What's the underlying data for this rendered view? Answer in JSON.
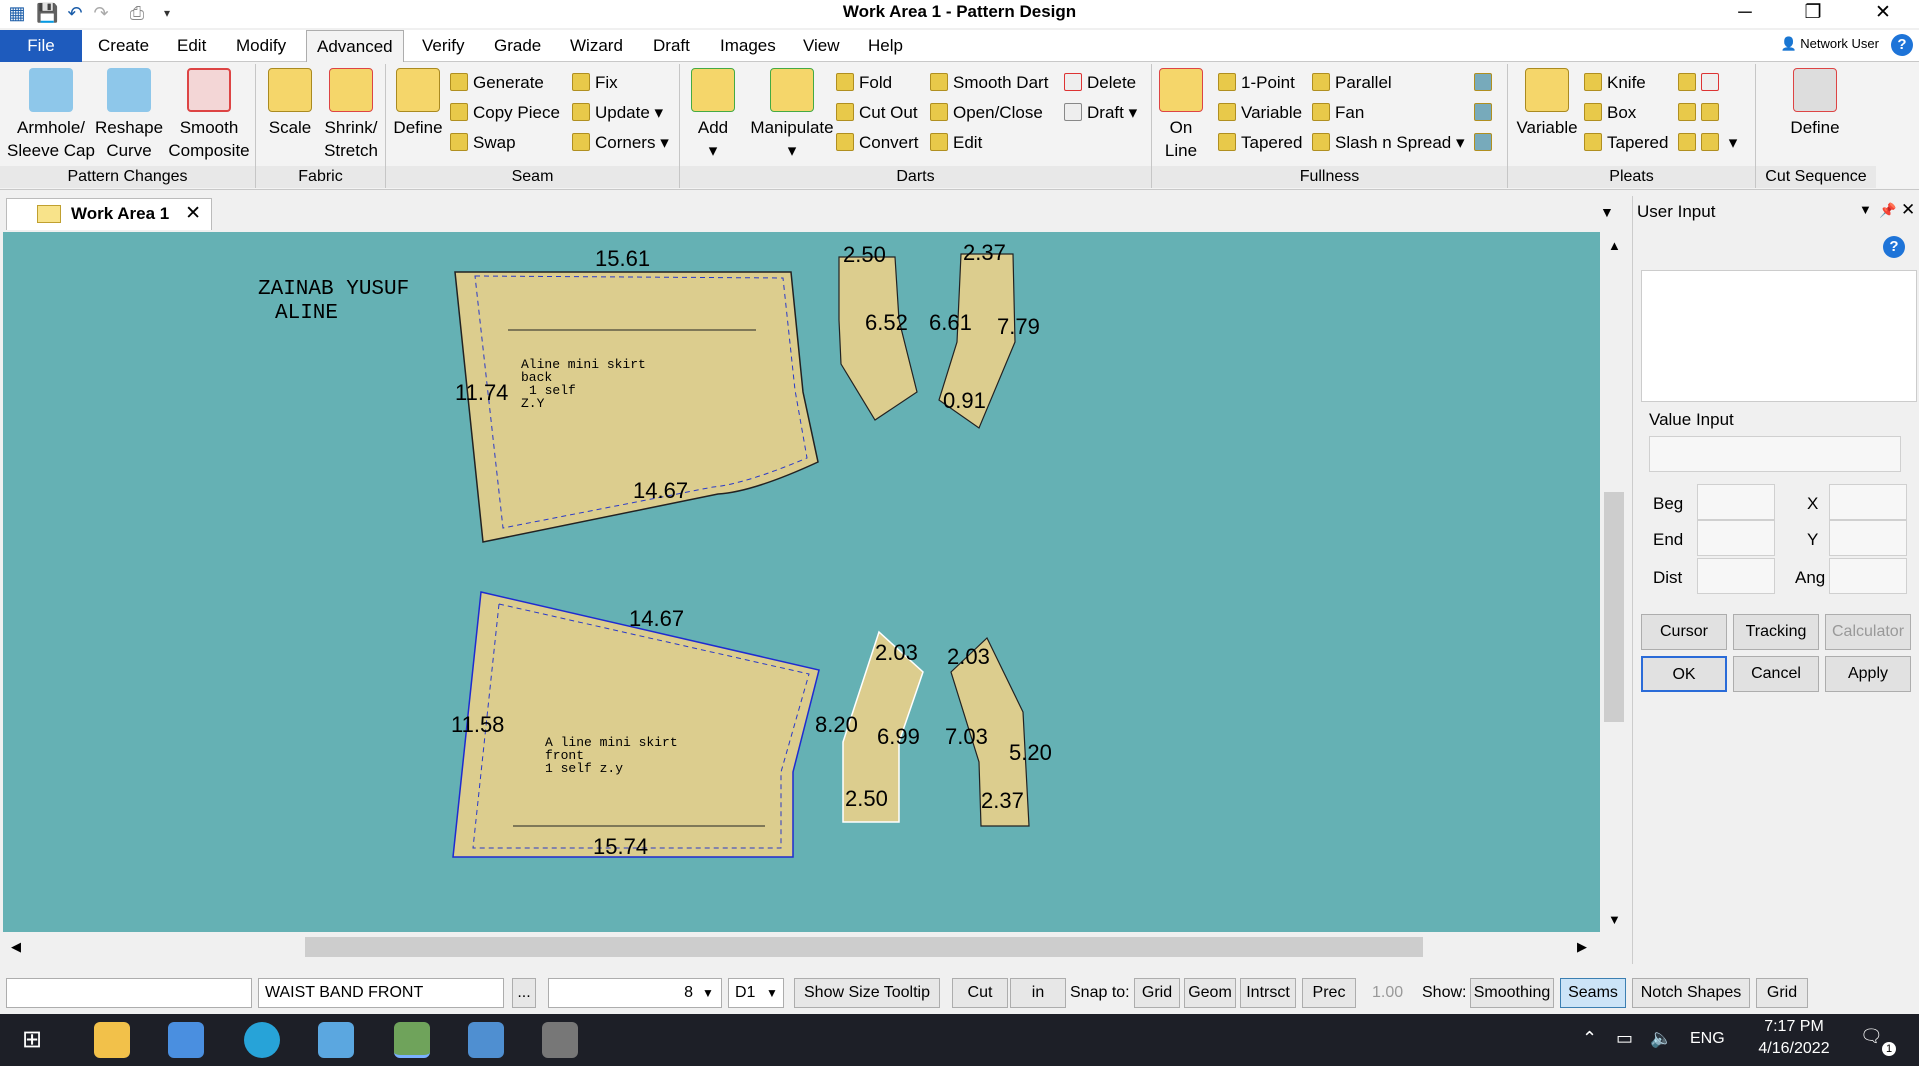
{
  "window": {
    "title": "Work Area 1 - Pattern Design"
  },
  "menu": {
    "file": "File",
    "items": [
      "Create",
      "Edit",
      "Modify",
      "Advanced",
      "Verify",
      "Grade",
      "Wizard",
      "Draft",
      "Images",
      "View",
      "Help"
    ],
    "network_user": "Network User"
  },
  "ribbon": {
    "pattern_changes": {
      "label": "Pattern Changes",
      "armhole": "Armhole/",
      "sleeve": "Sleeve Cap",
      "reshape": "Reshape",
      "curve": "Curve",
      "smooth": "Smooth",
      "composite": "Composite"
    },
    "fabric": {
      "label": "Fabric",
      "scale": "Scale",
      "shrink": "Shrink/",
      "stretch": "Stretch"
    },
    "seam": {
      "label": "Seam",
      "define": "Define",
      "generate": "Generate",
      "copy_piece": "Copy Piece",
      "swap": "Swap",
      "fix": "Fix",
      "update": "Update",
      "corners": "Corners"
    },
    "darts": {
      "label": "Darts",
      "add": "Add",
      "manipulate": "Manipulate",
      "fold": "Fold",
      "cut_out": "Cut Out",
      "convert": "Convert",
      "smooth_dart": "Smooth Dart",
      "open_close": "Open/Close",
      "edit": "Edit",
      "delete": "Delete",
      "draft": "Draft"
    },
    "fullness": {
      "label": "Fullness",
      "on": "On",
      "line": "Line",
      "one_point": "1-Point",
      "variable": "Variable",
      "tapered": "Tapered",
      "parallel": "Parallel",
      "fan": "Fan",
      "slash": "Slash n Spread"
    },
    "pleats": {
      "label": "Pleats",
      "variable": "Variable",
      "knife": "Knife",
      "box": "Box",
      "tapered": "Tapered"
    },
    "cut_sequence": {
      "label": "Cut Sequence",
      "define": "Define"
    }
  },
  "doc_tab": {
    "label": "Work Area 1"
  },
  "canvas": {
    "owner_text": "ZAINAB  YUSUF",
    "style_text": "ALINE",
    "back_piece": {
      "l1": "Aline mini skirt",
      "l2": "back",
      "l3": "1 self",
      "l4": "Z.Y",
      "top": "15.61",
      "side": "11.74",
      "bottom": "14.67"
    },
    "front_piece": {
      "l1": "A line mini skirt",
      "l2": "front",
      "l3": "1 self z.y",
      "top": "14.67",
      "side": "11.58",
      "bottom": "15.74"
    },
    "facings": [
      "2.50",
      "2.37",
      "6.52",
      "6.61",
      "7.79",
      "0.91",
      "2.03",
      "2.03",
      "8.20",
      "6.99",
      "7.03",
      "5.20",
      "2.50",
      "2.37"
    ]
  },
  "panel": {
    "title": "User Input",
    "value_input": "Value Input",
    "beg": "Beg",
    "end": "End",
    "dist": "Dist",
    "x": "X",
    "y": "Y",
    "ang": "Ang",
    "cursor": "Cursor",
    "tracking": "Tracking",
    "calculator": "Calculator",
    "ok": "OK",
    "cancel": "Cancel",
    "apply": "Apply"
  },
  "status": {
    "piece_name": "WAIST BAND FRONT",
    "ellipsis": "...",
    "size_value": "8",
    "d1": "D1",
    "show_size_tooltip": "Show Size Tooltip",
    "cut": "Cut",
    "unit": "in",
    "snap_to": "Snap to:",
    "grid": "Grid",
    "geom": "Geom",
    "intrsct": "Intrsct",
    "prec": "Prec",
    "prec_value": "1.00",
    "show": "Show:",
    "smoothing": "Smoothing",
    "seams": "Seams",
    "notch_shapes": "Notch Shapes",
    "grid2": "Grid"
  },
  "taskbar": {
    "lang": "ENG",
    "time": "7:17 PM",
    "date": "4/16/2022",
    "notif": "1"
  }
}
